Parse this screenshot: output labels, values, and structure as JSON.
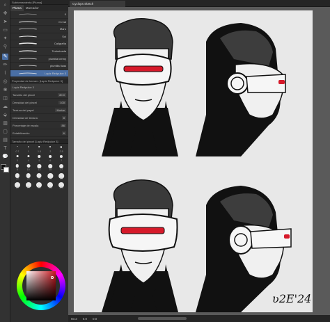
{
  "document": {
    "tab_title": "Cyclops sketch"
  },
  "brush_panel": {
    "tabs": [
      "Subherramienta [Pluma]",
      "Pluma",
      "Marcador"
    ],
    "brushes": [
      {
        "label": "",
        "size": "0"
      },
      {
        "label": "G real",
        "size": ""
      },
      {
        "label": "Maru",
        "size": ""
      },
      {
        "label": "Sol",
        "size": ""
      },
      {
        "label": "Caligrafía",
        "size": ""
      },
      {
        "label": "Texturizada",
        "size": ""
      },
      {
        "label": "plumilla kenny",
        "size": ""
      },
      {
        "label": "plumilla tizas",
        "size": ""
      },
      {
        "label": "Lapiz Redpulce 3",
        "size": ""
      }
    ],
    "selected_index": 8
  },
  "tool_property": {
    "header": "Propiedad de herram. [Lapiz Redpulce 3]",
    "tool_name": "Lapiz Redpulce 3",
    "rows": [
      {
        "label": "Tamaño del pincel",
        "value": "80.0"
      },
      {
        "label": "Densidad del pincel",
        "value": "100"
      },
      {
        "label": "Textura del papel",
        "value": "Mortar"
      },
      {
        "label": "Densidad de textura",
        "value": "8"
      },
      {
        "label": "Porcentaje de escala",
        "value": "86"
      },
      {
        "label": "Estabilización",
        "value": "6"
      }
    ]
  },
  "brush_size_panel": {
    "header": "Tamaño del pincel [Lapiz Redpulce 3]",
    "sizes": [
      "0.7",
      "1",
      "1.5",
      "2",
      "2.5",
      "3",
      "4",
      "5",
      "6",
      "7",
      "8",
      "10",
      "12",
      "15",
      "17",
      "20",
      "25",
      "30",
      "40",
      "50",
      "60",
      "70",
      "80",
      "100",
      "120"
    ]
  },
  "color": {
    "main": "#c8161d",
    "foreground": "#111111",
    "background": "#ffffff"
  },
  "status_bar": {
    "zoom": "50.2",
    "angle": "0.0",
    "extra": "0.0"
  },
  "artwork": {
    "signature": "ʋ2E'24"
  },
  "colors": {
    "accent": "#4a6fa5",
    "visor_red": "#d61a2a"
  }
}
